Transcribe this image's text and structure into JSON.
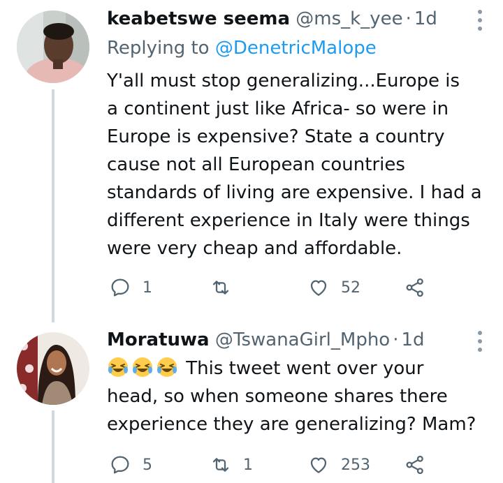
{
  "tweets": [
    {
      "display_name": "keabetswe seema",
      "handle": "@ms_k_yee",
      "separator": "·",
      "time": "1d",
      "replying_label": "Replying to",
      "replying_mention": "@DenetricMalope",
      "text_lines": [
        "Y'all must stop generalizing...Europe is",
        "a continent just like Africa- so were in",
        "Europe is expensive? State a country",
        "cause not all European countries",
        "standards of living are expensive. I had a",
        "different experience in Italy were things",
        "were very cheap and affordable."
      ],
      "reply_count": "1",
      "retweet_count": "",
      "like_count": "52"
    },
    {
      "display_name": "Moratuwa",
      "handle": "@TswanaGirl_Mpho",
      "separator": "·",
      "time": "1d",
      "emoji_icon": "face-with-tears-of-joy",
      "emoji_count": 3,
      "text_first": "This tweet went over your",
      "text_lines": [
        "head, so when someone shares there",
        "experience they are generalizing? Mam?"
      ],
      "reply_count": "5",
      "retweet_count": "1",
      "like_count": "253"
    }
  ],
  "icons": {
    "reply": "reply-icon",
    "retweet": "retweet-icon",
    "like": "heart-icon",
    "share": "share-icon",
    "more": "more-vertical-icon"
  },
  "colors": {
    "text": "#0f1419",
    "secondary": "#536471",
    "mention": "#1d9bf0",
    "thread_line": "#cfd9de"
  }
}
